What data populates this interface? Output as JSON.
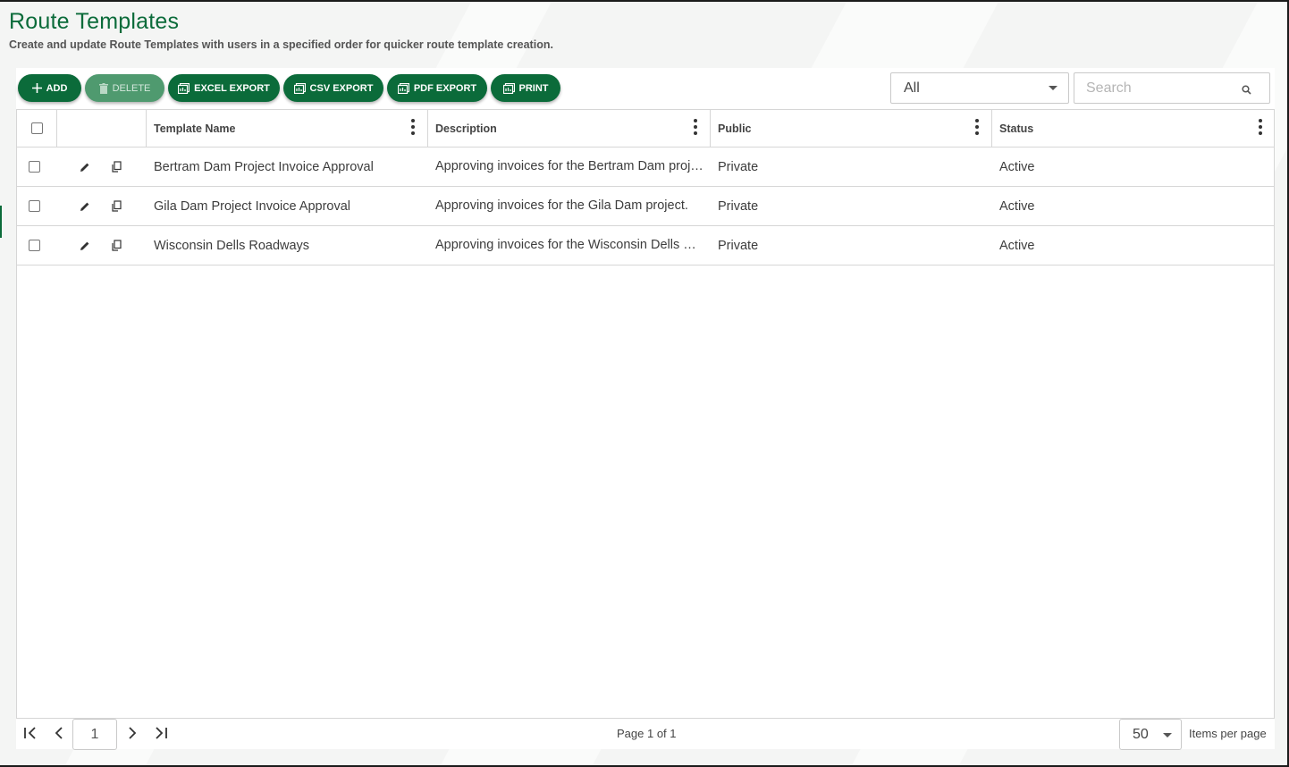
{
  "page": {
    "title": "Route Templates",
    "subtitle": "Create and update Route Templates with users in a specified order for quicker route template creation."
  },
  "toolbar": {
    "add_label": "ADD",
    "delete_label": "DELETE",
    "excel_label": "EXCEL EXPORT",
    "csv_label": "CSV EXPORT",
    "pdf_label": "PDF EXPORT",
    "print_label": "PRINT",
    "filter_value": "All",
    "search_placeholder": "Search"
  },
  "table": {
    "columns": [
      "Template Name",
      "Description",
      "Public",
      "Status"
    ],
    "rows": [
      {
        "name": "Bertram Dam Project Invoice Approval",
        "description": "Approving invoices for the Bertram Dam proje…",
        "public": "Private",
        "status": "Active"
      },
      {
        "name": "Gila Dam Project Invoice Approval",
        "description": "Approving invoices for the Gila Dam project.",
        "public": "Private",
        "status": "Active"
      },
      {
        "name": "Wisconsin Dells Roadways",
        "description": "Approving invoices for the Wisconsin Dells Ro…",
        "public": "Private",
        "status": "Active"
      }
    ]
  },
  "pager": {
    "current_page": "1",
    "page_info": "Page 1 of 1",
    "per_page": "50",
    "per_page_label": "Items per page"
  },
  "colors": {
    "primary": "#0b6b3a",
    "primary_disabled": "#4f9a6f"
  },
  "icons": [
    "plus-icon",
    "trash-icon",
    "export-icon",
    "print-icon",
    "search-icon",
    "pencil-icon",
    "copy-icon",
    "kebab-icon",
    "first-page-icon",
    "prev-page-icon",
    "next-page-icon",
    "last-page-icon",
    "caret-down-icon"
  ]
}
